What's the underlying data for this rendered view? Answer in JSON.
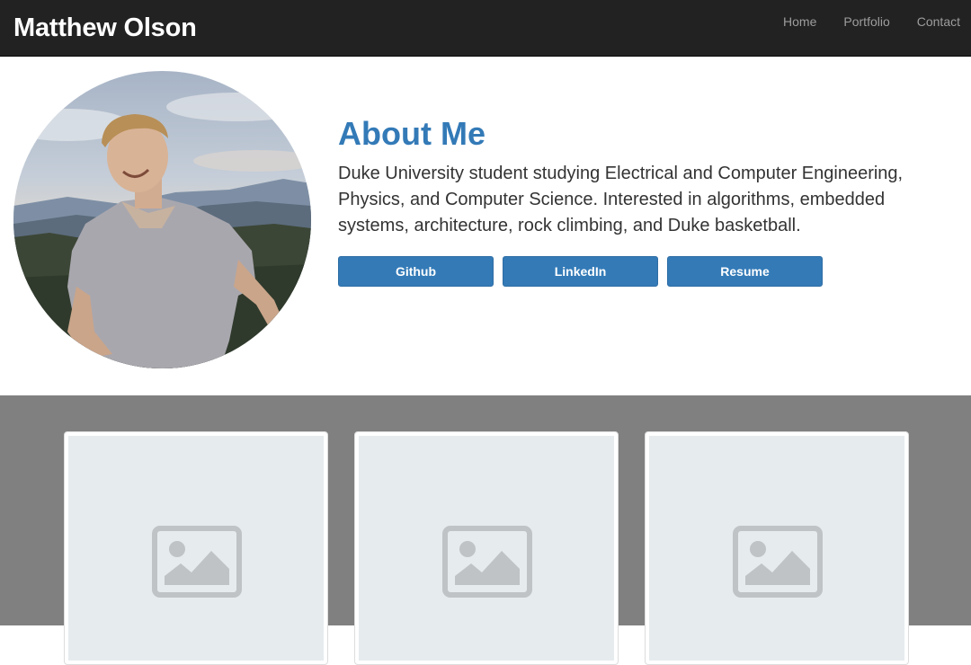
{
  "navbar": {
    "brand": "Matthew Olson",
    "links": [
      {
        "label": "Home"
      },
      {
        "label": "Portfolio"
      },
      {
        "label": "Contact"
      }
    ]
  },
  "about": {
    "avatar_icon": "profile-photo",
    "title": "About Me",
    "description": "Duke University student studying Electrical and Computer Engineering, Physics, and Computer Science. Interested in algorithms, embedded systems, architecture, rock climbing, and Duke basketball.",
    "buttons": [
      {
        "label": "Github"
      },
      {
        "label": "LinkedIn"
      },
      {
        "label": "Resume"
      }
    ]
  },
  "portfolio": {
    "items": [
      {
        "icon": "image-placeholder-icon"
      },
      {
        "icon": "image-placeholder-icon"
      },
      {
        "icon": "image-placeholder-icon"
      }
    ]
  },
  "colors": {
    "navbar_bg": "#222222",
    "brand": "#ffffff",
    "nav_link": "#9d9d9d",
    "accent": "#337ab7",
    "portfolio_bg": "#808080",
    "thumb_bg": "#e6ebee",
    "placeholder_icon": "#bfc3c6"
  }
}
